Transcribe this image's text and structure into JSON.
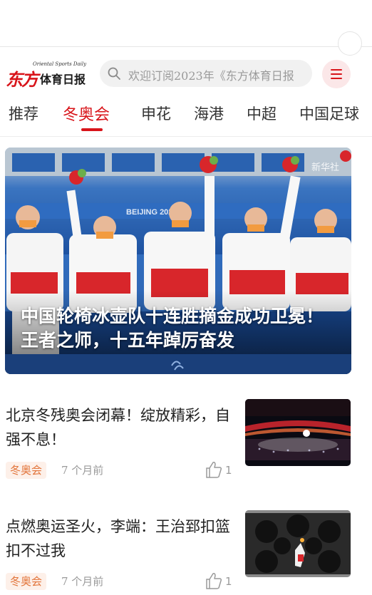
{
  "header": {
    "logo_small": "Oriental Sports Daily",
    "logo_red": "东方",
    "logo_black": "体育日报",
    "search_placeholder": "欢迎订阅2023年《东方体育日报"
  },
  "tabs": [
    {
      "label": "推荐"
    },
    {
      "label": "冬奥会",
      "active": true
    },
    {
      "label": "申花"
    },
    {
      "label": "海港"
    },
    {
      "label": "中超"
    },
    {
      "label": "中国足球"
    }
  ],
  "hero": {
    "title": "中国轮椅冰壶队十连胜摘金成功卫冕！王者之师，十五年踔厉奋发",
    "bg_text": "BEIJING 2022",
    "watermark": "新华社"
  },
  "news": [
    {
      "title": "北京冬残奥会闭幕！绽放精彩，自强不息！",
      "tag": "冬奥会",
      "time": "7 个月前",
      "likes": "1"
    },
    {
      "title": "点燃奥运圣火，李端：王治郅扣篮扣不过我",
      "tag": "冬奥会",
      "time": "7 个月前",
      "likes": "1"
    }
  ],
  "colors": {
    "accent": "#d8141a",
    "tag": "#e2743a",
    "hero_blue": "#1e5aa8"
  },
  "icons": {
    "search": "search-icon",
    "menu": "menu-icon",
    "like": "thumbs-up-icon"
  }
}
